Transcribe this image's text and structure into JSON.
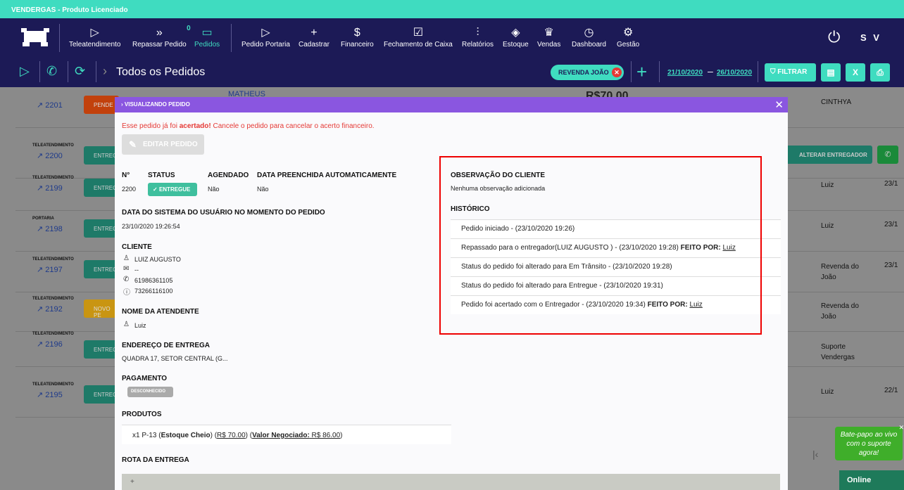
{
  "topbar": {
    "title": "VENDERGAS - Produto Licenciado"
  },
  "nav": {
    "items": [
      {
        "label": "Teleatendimento",
        "icon": "send-icon"
      },
      {
        "label": "Repassar Pedido",
        "icon": "double-chevron-icon",
        "badge": "0"
      },
      {
        "label": "Pedidos",
        "icon": "clipboard-icon"
      },
      {
        "label": "Pedido Portaria",
        "icon": "send-icon"
      },
      {
        "label": "Cadastrar",
        "icon": "plus-icon"
      },
      {
        "label": "Financeiro",
        "icon": "dollar-icon"
      },
      {
        "label": "Fechamento de Caixa",
        "icon": "checkbox-icon"
      },
      {
        "label": "Relatórios",
        "icon": "sliders-icon"
      },
      {
        "label": "Estoque",
        "icon": "dropbox-icon"
      },
      {
        "label": "Vendas",
        "icon": "crown-icon"
      },
      {
        "label": "Dashboard",
        "icon": "clock-icon"
      },
      {
        "label": "Gestão",
        "icon": "gears-icon"
      }
    ],
    "user": "S V"
  },
  "subbar": {
    "title": "Todos os Pedidos",
    "chip": "REVENDA JOÃO",
    "date_from": "21/10/2020",
    "date_to": "26/10/2020",
    "filter_label": "FILTRAR"
  },
  "bg": {
    "rows": [
      {
        "tag": "",
        "num": "2201",
        "btn": "PENDE",
        "c1": "CINTHYA",
        "c2": ""
      },
      {
        "tag": "TELEATENDIMENTO",
        "num": "2200",
        "btn": "ENTREG",
        "c1": "",
        "c2": ""
      },
      {
        "tag": "TELEATENDIMENTO",
        "num": "2199",
        "btn": "ENTREG",
        "c1": "Luiz",
        "c2": "23/1"
      },
      {
        "tag": "PORTARIA",
        "num": "2198",
        "btn": "ENTREG",
        "c1": "Luiz",
        "c2": "23/1"
      },
      {
        "tag": "TELEATENDIMENTO",
        "num": "2197",
        "btn": "ENTREG",
        "c1": "Revenda do João",
        "c2": "23/1"
      },
      {
        "tag": "TELEATENDIMENTO",
        "num": "2192",
        "btn": "NOVO PE",
        "c1": "Revenda do João",
        "c2": ""
      },
      {
        "tag": "TELEATENDIMENTO",
        "num": "2196",
        "btn": "ENTREG",
        "c1": "Suporte Vendergas",
        "c2": ""
      },
      {
        "tag": "TELEATENDIMENTO",
        "num": "2195",
        "btn": "ENTREG",
        "c1": "Luiz",
        "c2": "22/1"
      }
    ],
    "client_name": "MATHEUS",
    "price": "R$70,00",
    "alter_btn": "ALTERAR ENTREGADOR"
  },
  "modal": {
    "header": "VISUALIZANDO PEDIDO",
    "warning_pre": "Esse pedido já foi ",
    "warning_bold": "acertado!",
    "warning_post": " Cancele o pedido para cancelar o acerto financeiro.",
    "edit_label": "EDITAR PEDIDO",
    "labels": {
      "num": "N°",
      "status": "STATUS",
      "agendado": "AGENDADO",
      "data_auto": "DATA PREENCHIDA AUTOMATICAMENTE",
      "data_sistema": "DATA DO SISTEMA DO USUÁRIO NO MOMENTO DO PEDIDO",
      "cliente": "CLIENTE",
      "atendente": "NOME DA ATENDENTE",
      "endereco": "ENDEREÇO DE ENTREGA",
      "pagamento": "PAGAMENTO",
      "produtos": "PRODUTOS",
      "rota": "ROTA DA ENTREGA",
      "obs": "OBSERVAÇÃO DO CLIENTE",
      "historico": "HISTÓRICO"
    },
    "values": {
      "num": "2200",
      "status": "ENTREGUE",
      "agendado": "Não",
      "data_auto": "Não",
      "data_sistema": "23/10/2020 19:26:54",
      "cliente_nome": "LUIZ AUGUSTO",
      "cliente_email": "--",
      "cliente_tel1": "61986361105",
      "cliente_tel2": "73266116100",
      "atendente": "Luiz",
      "endereco": "QUADRA 17, SETOR CENTRAL (G...",
      "pagamento": "DESCONHECIDO",
      "obs": "Nenhuma observação adicionada"
    },
    "produto": {
      "qty_name": "x1 P-13 (",
      "estoque": "Estoque Cheio",
      "close1": ") (",
      "preco": "R$ 70.00",
      "close2": ") (",
      "negociado_label": "Valor Negociado:",
      "negociado": " R$ 86.00",
      "close3": ")"
    },
    "historico": [
      {
        "text": "Pedido iniciado - (23/10/2020 19:26)",
        "feito": "",
        "user": ""
      },
      {
        "text": "Repassado para o entregador(LUIZ AUGUSTO ) - (23/10/2020 19:28) ",
        "feito": "FEITO POR:",
        "user": "Luiz"
      },
      {
        "text": "Status do pedido foi alterado para Em Trânsito - (23/10/2020 19:28)",
        "feito": "",
        "user": ""
      },
      {
        "text": "Status do pedido foi alterado para Entregue - (23/10/2020 19:31)",
        "feito": "",
        "user": ""
      },
      {
        "text": "Pedido foi acertado com o Entregador - (23/10/2020 19:34) ",
        "feito": "FEITO POR:",
        "user": "Luiz"
      }
    ]
  },
  "chat": {
    "text": "Bate-papo ao vivo com o suporte agora!",
    "online": "Online"
  }
}
